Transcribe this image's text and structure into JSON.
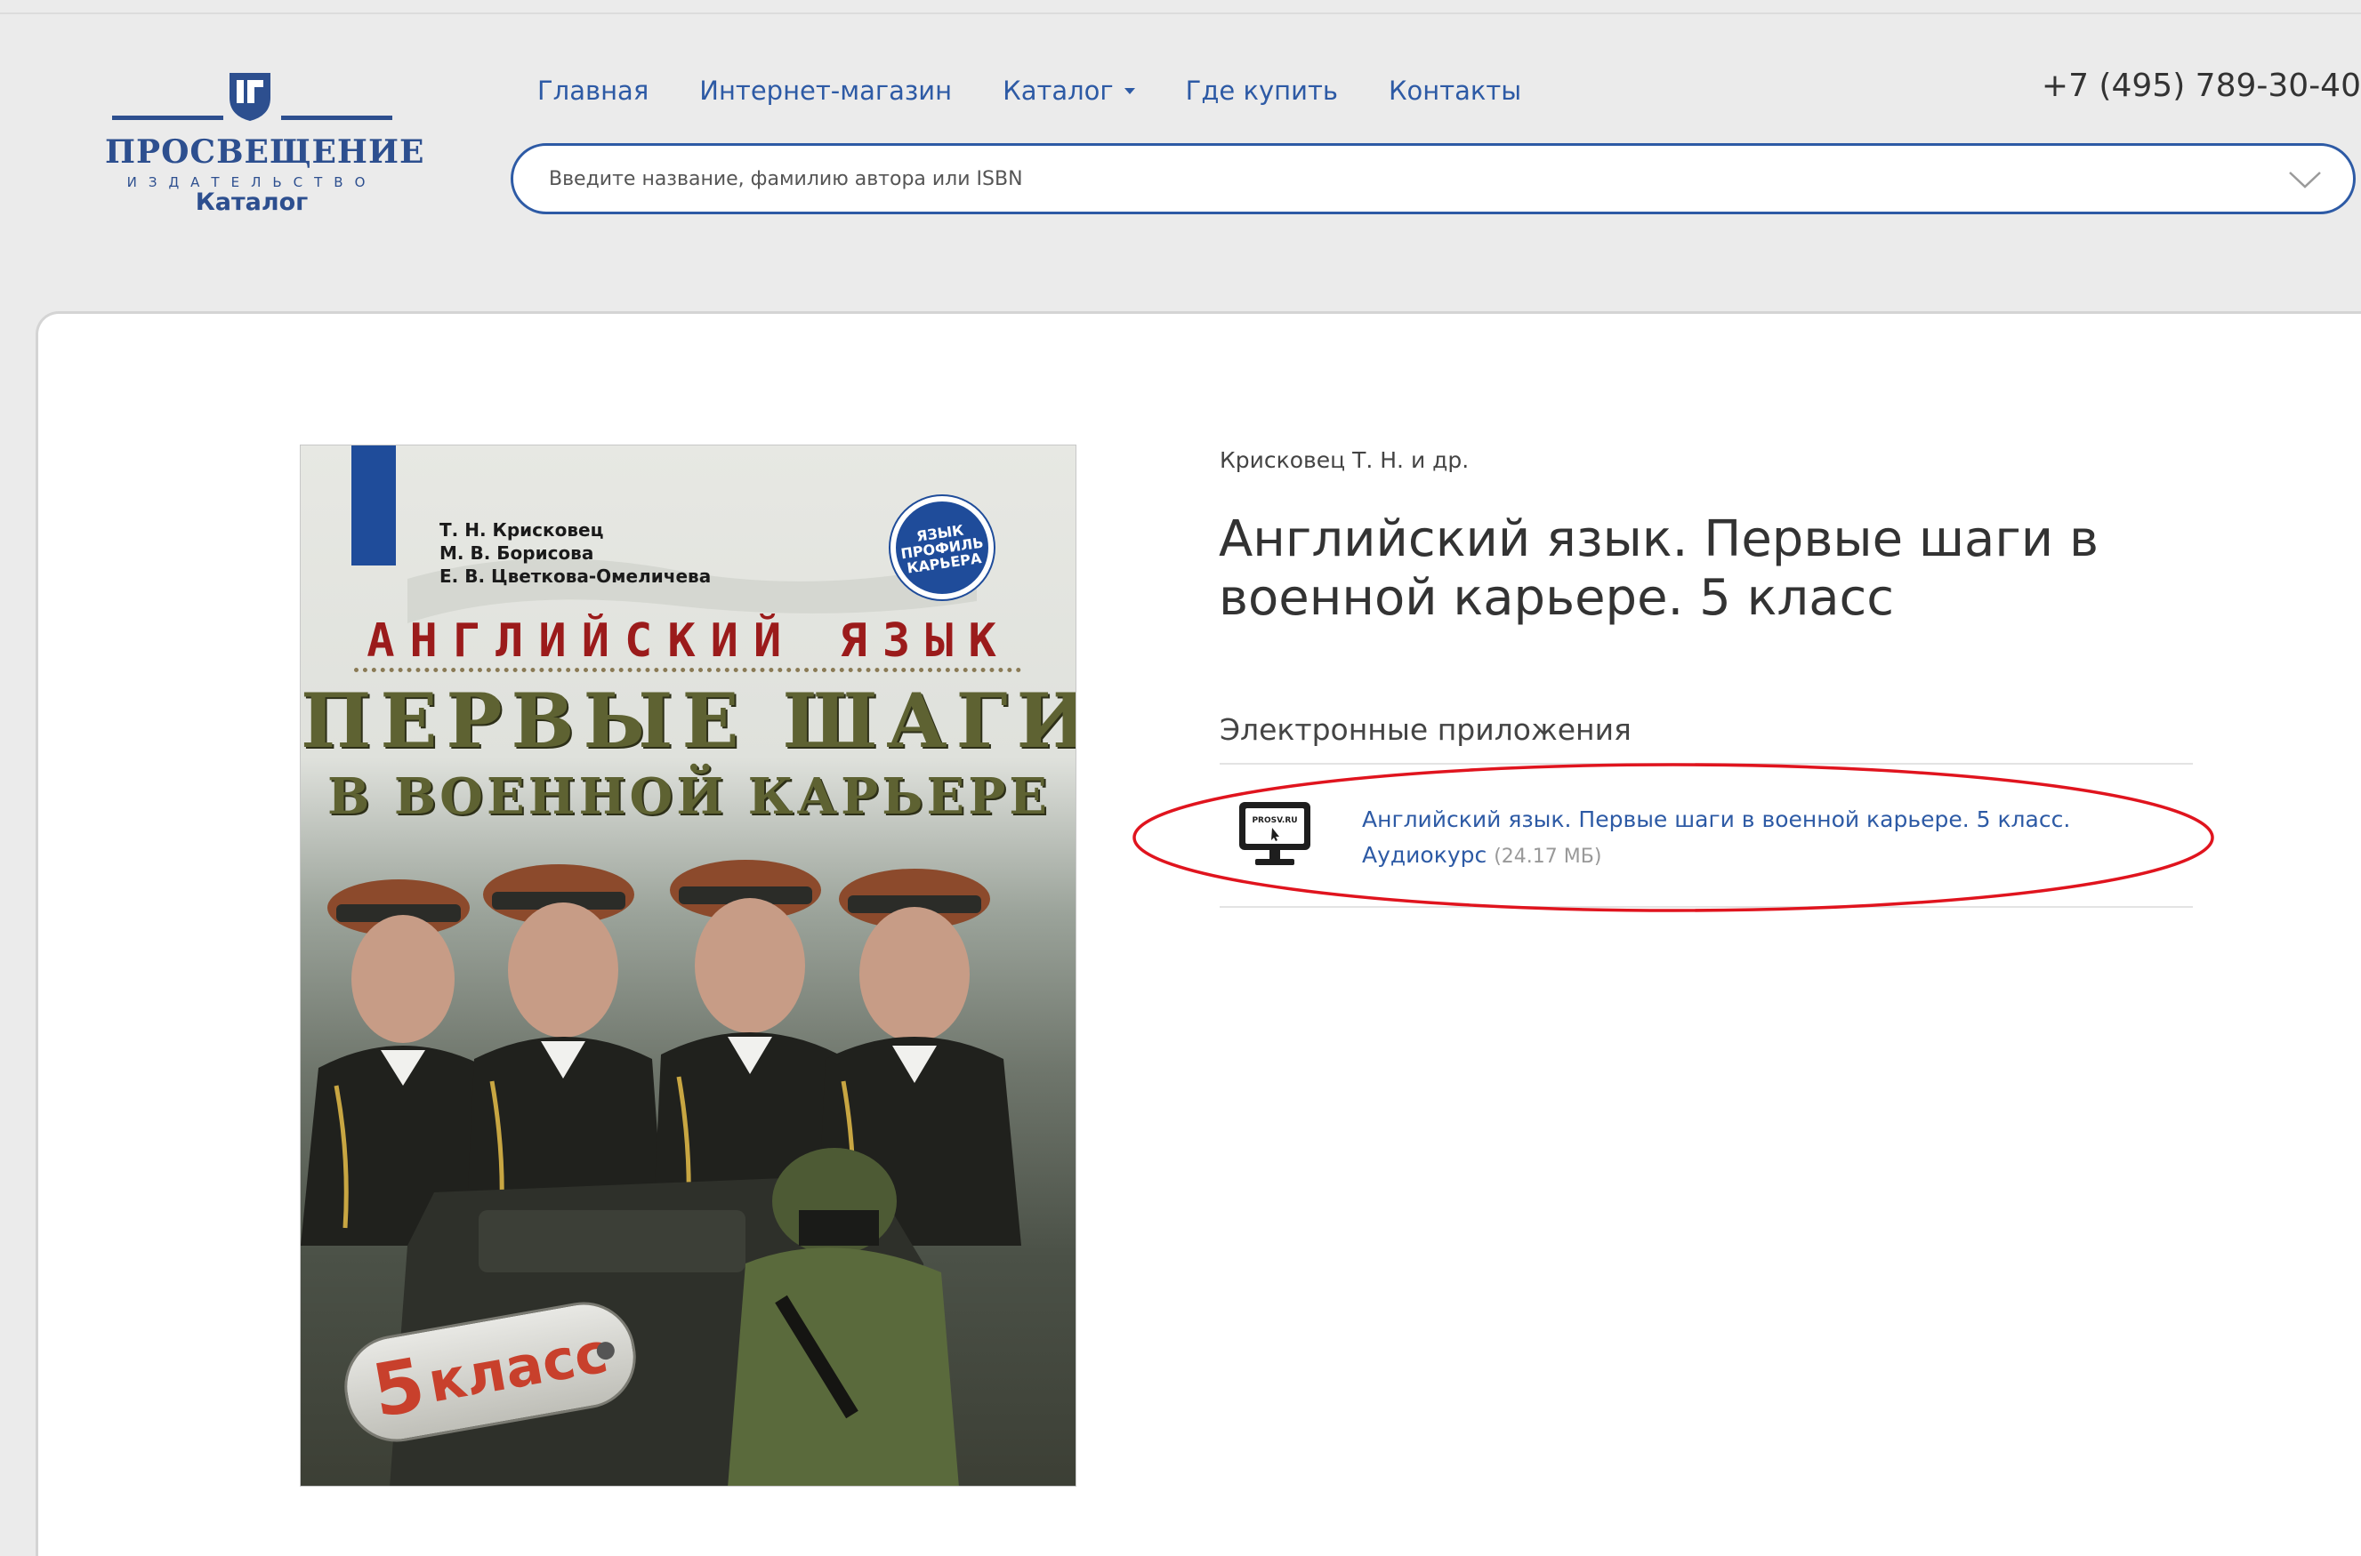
{
  "header": {
    "logo": {
      "brand": "ПРОСВЕЩЕНИЕ",
      "tagline": "ИЗДАТЕЛЬСТВО",
      "section": "Каталог"
    },
    "nav": [
      {
        "label": "Главная"
      },
      {
        "label": "Интернет-магазин"
      },
      {
        "label": "Каталог"
      },
      {
        "label": "Где купить"
      },
      {
        "label": "Контакты"
      }
    ],
    "phone": "+7 (495) 789-30-40",
    "search": {
      "placeholder": "Введите название, фамилию автора или ISBN"
    }
  },
  "book": {
    "author": "Крисковец Т. Н. и др.",
    "title": "Английский язык. Первые шаги в военной карьере. 5 класс",
    "cover": {
      "authors": [
        "Т. Н. Крисковец",
        "М. В. Борисова",
        "Е. В. Цветкова-Омеличева"
      ],
      "badge": "ЯЗЫК ПРОФИЛЬ КАРЬЕРА",
      "title_line1": "АНГЛИЙСКИЙ ЯЗЫК",
      "title_line2": "ПЕРВЫЕ ШАГИ",
      "title_line3": "В ВОЕННОЙ КАРЬЕРЕ",
      "grade_number": "5",
      "grade_word": "класс"
    }
  },
  "apps": {
    "heading": "Электронные приложения",
    "items": [
      {
        "icon_label": "PROSV.RU",
        "title": "Английский язык. Первые шаги в военной карьере. 5 класс. Аудиокурс",
        "size": "(24.17 МБ)"
      }
    ]
  },
  "colors": {
    "brand_blue": "#2d4f8f",
    "link_blue": "#2d5aa5",
    "highlight_red": "#e0141e",
    "page_bg": "#ebebeb"
  }
}
